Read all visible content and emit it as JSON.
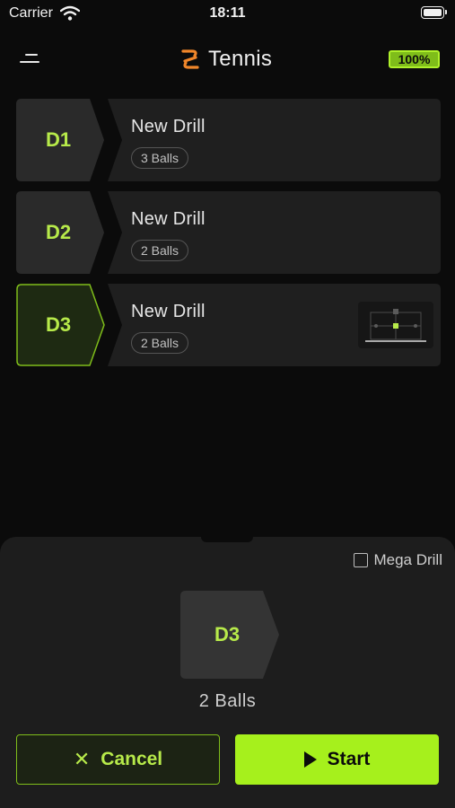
{
  "status_bar": {
    "carrier": "Carrier",
    "time": "18:11"
  },
  "header": {
    "title": "Tennis",
    "battery_percent": "100%"
  },
  "drills": [
    {
      "tag": "D1",
      "title": "New Drill",
      "balls": "3 Balls",
      "selected": false,
      "has_court_preview": false
    },
    {
      "tag": "D2",
      "title": "New Drill",
      "balls": "2 Balls",
      "selected": false,
      "has_court_preview": false
    },
    {
      "tag": "D3",
      "title": "New Drill",
      "balls": "2 Balls",
      "selected": true,
      "has_court_preview": true
    }
  ],
  "sheet": {
    "mega_drill_label": "Mega Drill",
    "mega_drill_checked": false,
    "selected_tag": "D3",
    "balls_caption": "2 Balls",
    "cancel_label": "Cancel",
    "start_label": "Start"
  },
  "colors": {
    "accent": "#a6f01c",
    "accent_text": "#b7ea4a",
    "brand_orange": "#f0862a",
    "background": "#0b0b0b",
    "card": "#1f1f1f"
  },
  "icons": {
    "menu": "menu-icon",
    "logo": "tennis-logo-icon",
    "wifi": "wifi-icon",
    "battery": "battery-icon",
    "cancel": "close-icon",
    "start": "play-icon"
  }
}
